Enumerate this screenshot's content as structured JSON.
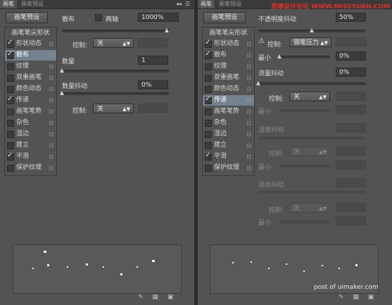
{
  "left_panel": {
    "tabs": [
      "画笔",
      "画笔预设"
    ],
    "preset_button": "画笔预设",
    "header": "画笔笔尖形状",
    "items": [
      {
        "label": "形状动态",
        "checked": true,
        "lock": true
      },
      {
        "label": "散布",
        "checked": true,
        "lock": true
      },
      {
        "label": "纹理",
        "checked": false,
        "lock": true
      },
      {
        "label": "双重画笔",
        "checked": false,
        "lock": true
      },
      {
        "label": "颜色动态",
        "checked": false,
        "lock": true
      },
      {
        "label": "传递",
        "checked": true,
        "lock": true
      },
      {
        "label": "画笔笔势",
        "checked": false,
        "lock": true
      },
      {
        "label": "杂色",
        "checked": false,
        "lock": true
      },
      {
        "label": "湿边",
        "checked": false,
        "lock": true
      },
      {
        "label": "建立",
        "checked": false,
        "lock": true
      },
      {
        "label": "平滑",
        "checked": true,
        "lock": true
      },
      {
        "label": "保护纹理",
        "checked": false,
        "lock": true
      }
    ],
    "selected_index": 1,
    "scatter_label": "散布",
    "two_axis_label": "两轴",
    "scatter_value": "1000%",
    "control_label_1": "控制:",
    "control_value_1": "关",
    "count_label": "数量",
    "count_value": "1",
    "count_jitter_label": "数量抖动",
    "count_jitter_value": "0%",
    "control_label_2": "控制:",
    "control_value_2": "关"
  },
  "right_panel": {
    "tabs": [
      "画笔",
      "画笔预设"
    ],
    "preset_button": "画笔预设",
    "header": "画笔笔尖形状",
    "items": [
      {
        "label": "形状动态",
        "checked": true,
        "lock": true
      },
      {
        "label": "散布",
        "checked": true,
        "lock": true
      },
      {
        "label": "纹理",
        "checked": false,
        "lock": true
      },
      {
        "label": "双重画笔",
        "checked": false,
        "lock": true
      },
      {
        "label": "颜色动态",
        "checked": false,
        "lock": true
      },
      {
        "label": "传递",
        "checked": true,
        "lock": true
      },
      {
        "label": "画笔笔势",
        "checked": false,
        "lock": true
      },
      {
        "label": "杂色",
        "checked": false,
        "lock": true
      },
      {
        "label": "湿边",
        "checked": false,
        "lock": true
      },
      {
        "label": "建立",
        "checked": false,
        "lock": true
      },
      {
        "label": "平滑",
        "checked": true,
        "lock": true
      },
      {
        "label": "保护纹理",
        "checked": false,
        "lock": true
      }
    ],
    "selected_index": 5,
    "opacity_jitter_label": "不透明度抖动",
    "opacity_jitter_value": "50%",
    "control_label_1": "控制:",
    "control_value_1": "钢笔压力",
    "min_label_1": "最小",
    "min_value_1": "0%",
    "flow_jitter_label": "流量抖动",
    "flow_jitter_value": "0%",
    "control_label_2": "控制:",
    "control_value_2": "关",
    "min_label_2": "最小",
    "wetness_jitter_label": "湿度抖动",
    "control_label_3": "控制:",
    "control_value_3": "关",
    "min_label_3": "最小",
    "mix_jitter_label": "混合抖动",
    "control_label_4": "控制:",
    "control_value_4": "关",
    "min_label_4": "最小"
  },
  "watermarks": {
    "top": "思缘设计论坛 WWW.MISSYUAN.COM",
    "bottom": "post of uimaker.com"
  },
  "colors": {
    "panel_bg": "#535353",
    "selection": "#74818e",
    "field_bg": "#3c3c3c",
    "watermark_red": "#d8312a"
  }
}
